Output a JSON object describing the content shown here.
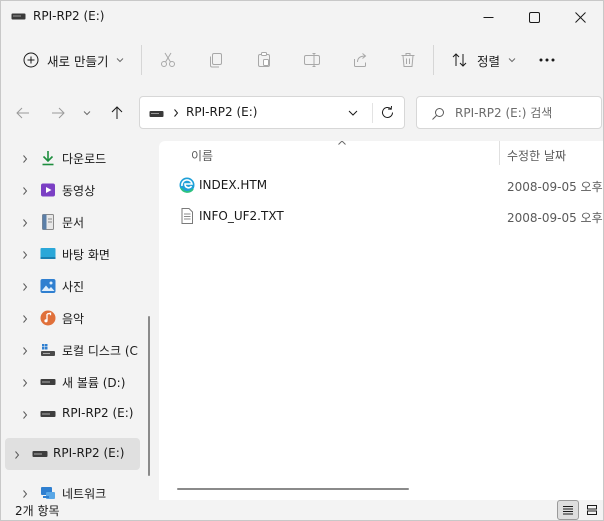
{
  "window": {
    "title": "RPI-RP2 (E:)"
  },
  "toolbar": {
    "new_label": "새로 만들기",
    "sort_label": "정렬"
  },
  "address": {
    "path": "RPI-RP2 (E:)"
  },
  "search": {
    "placeholder": "RPI-RP2 (E:) 검색"
  },
  "sidebar": {
    "items": [
      {
        "label": "다운로드",
        "icon": "download-icon"
      },
      {
        "label": "동영상",
        "icon": "video-icon"
      },
      {
        "label": "문서",
        "icon": "document-icon"
      },
      {
        "label": "바탕 화면",
        "icon": "desktop-icon"
      },
      {
        "label": "사진",
        "icon": "pictures-icon"
      },
      {
        "label": "음악",
        "icon": "music-icon"
      },
      {
        "label": "로컬 디스크 (C",
        "icon": "local-disk-icon"
      },
      {
        "label": "새 볼륨 (D:)",
        "icon": "drive-icon"
      },
      {
        "label": "RPI-RP2 (E:)",
        "icon": "drive-icon"
      },
      {
        "label": "RPI-RP2 (E:)",
        "icon": "drive-icon",
        "selected": true
      },
      {
        "label": "네트워크",
        "icon": "network-icon"
      }
    ]
  },
  "content": {
    "columns": {
      "name": "이름",
      "date": "수정한 날짜"
    },
    "files": [
      {
        "name": "INDEX.HTM",
        "date": "2008-09-05 오후",
        "icon": "edge-html-icon"
      },
      {
        "name": "INFO_UF2.TXT",
        "date": "2008-09-05 오후",
        "icon": "text-file-icon"
      }
    ]
  },
  "status": {
    "count": "2개 항목"
  },
  "colors": {
    "accent_blue": "#0078d4",
    "selection": "#e0e0e0",
    "background": "#f3f3f3"
  }
}
